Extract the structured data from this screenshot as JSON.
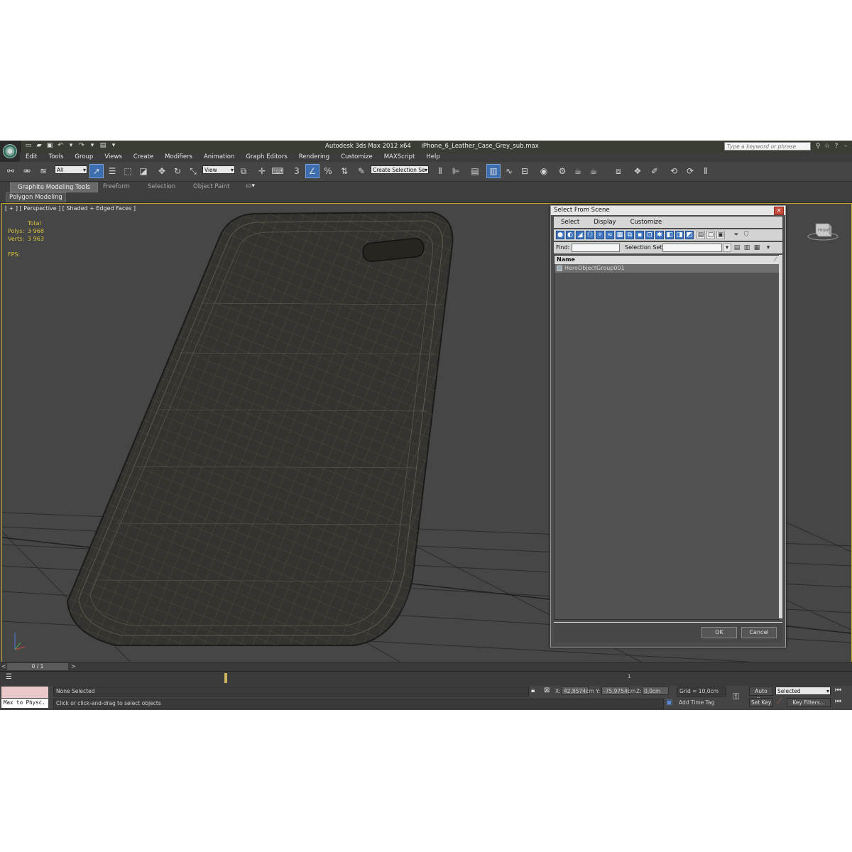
{
  "window": {
    "app_name": "Autodesk 3ds Max  2012 x64",
    "file_name": "iPhone_6_Leather_Case_Grey_sub.max",
    "search_placeholder": "Type a keyword or phrase"
  },
  "menu": [
    "Edit",
    "Tools",
    "Group",
    "Views",
    "Create",
    "Modifiers",
    "Animation",
    "Graph Editors",
    "Rendering",
    "Customize",
    "MAXScript",
    "Help"
  ],
  "toolbar": {
    "selection_filter": "All",
    "reference_coord": "View",
    "snap_label": "3",
    "named_selection_set": "Create Selection Se"
  },
  "ribbon": {
    "tabs": [
      "Graphite Modeling Tools",
      "Freeform",
      "Selection",
      "Object Paint"
    ],
    "active_tab": "Graphite Modeling Tools",
    "sub_panel": "Polygon Modeling"
  },
  "viewport": {
    "label": "[ + ] [ Perspective ] [ Shaded + Edged Faces ]",
    "stats": {
      "total_label": "Total",
      "polys_label": "Polys:",
      "polys_value": "3 968",
      "verts_label": "Verts:",
      "verts_value": "3 963",
      "fps_label": "FPS:"
    },
    "viewcube_label": "FRONT"
  },
  "dialog": {
    "title": "Select From Scene",
    "menu": [
      "Select",
      "Display",
      "Customize"
    ],
    "find_label": "Find:",
    "selection_set_label": "Selection Set:",
    "column_header": "Name",
    "items": [
      "HeroObjectGroup001"
    ],
    "ok": "OK",
    "cancel": "Cancel"
  },
  "timeline": {
    "frame_counter": "0 / 1",
    "track_tick": "1"
  },
  "status": {
    "maxscript": "Max to Physc.",
    "selection": "None Selected",
    "prompt": "Click or click-and-drag to select objects",
    "x_label": "X:",
    "x_value": "42,8574cm",
    "y_label": "Y:",
    "y_value": "-75,9754cm",
    "z_label": "Z:",
    "z_value": "0,0cm",
    "grid": "Grid = 10,0cm",
    "add_time_tag": "Add Time Tag",
    "auto_key": "Auto Key",
    "set_key": "Set Key",
    "key_mode": "Selected",
    "key_filters": "Key Filters..."
  }
}
